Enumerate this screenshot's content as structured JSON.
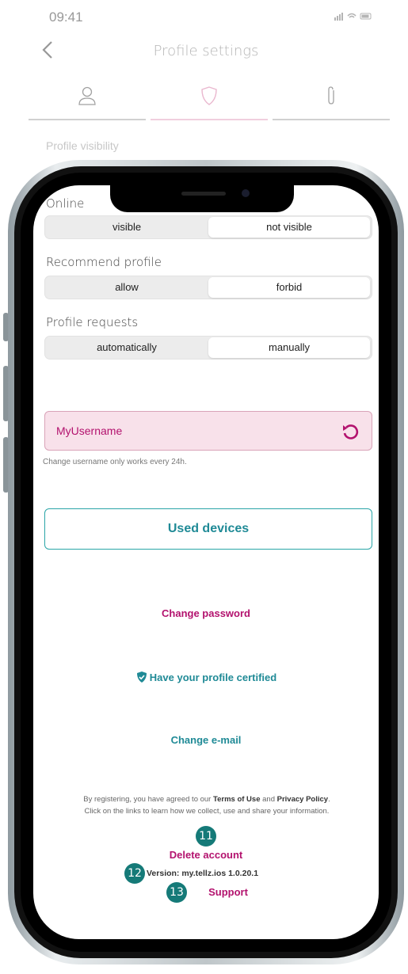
{
  "status_bar": {
    "time": "09:41",
    "icons": "▐▐▐ ◠ ▭"
  },
  "nav": {
    "title": "Profile settings"
  },
  "tabs": [
    {
      "icon": "person-icon",
      "active": false
    },
    {
      "icon": "shield-icon",
      "active": true
    },
    {
      "icon": "paperclip-icon",
      "active": false
    }
  ],
  "background_section": {
    "title": "Profile visibility"
  },
  "settings": {
    "online": {
      "label": "Online",
      "options": [
        "visible",
        "not visible"
      ],
      "selected": "not visible"
    },
    "recommend": {
      "label": "Recommend profile",
      "options": [
        "allow",
        "forbid"
      ],
      "selected": "forbid"
    },
    "requests": {
      "label": "Profile requests",
      "options": [
        "automatically",
        "manually"
      ],
      "selected": "manually"
    }
  },
  "username": {
    "value": "MyUsername",
    "hint": "Change username only works every 24h."
  },
  "buttons": {
    "used_devices": "Used devices",
    "change_password": "Change password",
    "certify": "Have your profile certified",
    "change_email": "Change e-mail",
    "delete_account": "Delete account",
    "support": "Support"
  },
  "legal": {
    "line1_prefix": "By registering, you have agreed to our ",
    "terms": "Terms of Use",
    "and": " and ",
    "privacy": "Privacy Policy",
    "line1_suffix": ".",
    "line2": "Click on the links to learn how we collect, use and share your information."
  },
  "version": "Version: my.tellz.ios 1.0.20.1",
  "markers": [
    "11",
    "12",
    "13"
  ],
  "colors": {
    "accent_pink": "#b3126e",
    "accent_teal": "#1f8a96",
    "marker": "#157a78",
    "username_bg": "#f8e1ea"
  }
}
